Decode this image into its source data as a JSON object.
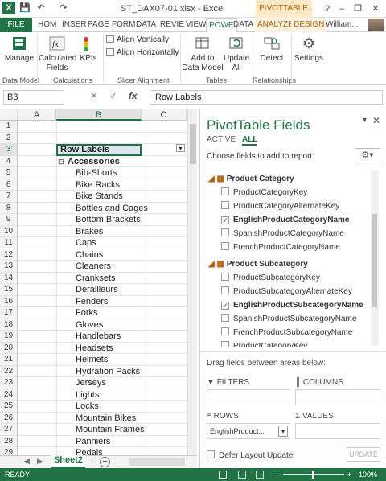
{
  "window": {
    "title": "ST_DAX07-01.xlsx - Excel",
    "pivot_context": "PIVOTTABLE...",
    "help": "?",
    "minimize": "–",
    "restore": "❐",
    "close": "✕"
  },
  "quick_access": {
    "save": "💾",
    "undo": "↶",
    "redo": "↷"
  },
  "tabs": [
    "FILE",
    "HOM",
    "INSER",
    "PAGE",
    "FORM",
    "DATA",
    "REVIE",
    "VIEW",
    "POWE",
    "DATA",
    "ANALYZE",
    "DESIGN"
  ],
  "active_tab": "POWE",
  "user": "William...",
  "ribbon": {
    "manage": "Manage",
    "calc_fields": "Calculated",
    "calc_fields2": "Fields",
    "kpis": "KPIs",
    "align_v": "Align Vertically",
    "align_h": "Align Horizontally",
    "add_dm": "Add to",
    "add_dm2": "Data Model",
    "update_all": "Update",
    "update_all2": "All",
    "detect": "Detect",
    "settings": "Settings",
    "groups": {
      "data_model": "Data Model",
      "calculations": "Calculations",
      "slicer": "Slicer Alignment",
      "tables": "Tables",
      "relationships": "Relationships"
    }
  },
  "formula_bar": {
    "name_box": "B3",
    "value": "Row Labels",
    "fx": "fx",
    "cancel": "✕",
    "enter": "✓"
  },
  "grid": {
    "columns": [
      "A",
      "B",
      "C"
    ],
    "rows": [
      {
        "n": "1",
        "b": ""
      },
      {
        "n": "2",
        "b": ""
      },
      {
        "n": "3",
        "b": "Row Labels"
      },
      {
        "n": "4",
        "b": "Accessories"
      },
      {
        "n": "5",
        "b": "Bib-Shorts"
      },
      {
        "n": "6",
        "b": "Bike Racks"
      },
      {
        "n": "7",
        "b": "Bike Stands"
      },
      {
        "n": "8",
        "b": "Bottles and Cages"
      },
      {
        "n": "9",
        "b": "Bottom Brackets"
      },
      {
        "n": "10",
        "b": "Brakes"
      },
      {
        "n": "11",
        "b": "Caps"
      },
      {
        "n": "12",
        "b": "Chains"
      },
      {
        "n": "13",
        "b": "Cleaners"
      },
      {
        "n": "14",
        "b": "Cranksets"
      },
      {
        "n": "15",
        "b": "Derailleurs"
      },
      {
        "n": "16",
        "b": "Fenders"
      },
      {
        "n": "17",
        "b": "Forks"
      },
      {
        "n": "18",
        "b": "Gloves"
      },
      {
        "n": "19",
        "b": "Handlebars"
      },
      {
        "n": "20",
        "b": "Headsets"
      },
      {
        "n": "21",
        "b": "Helmets"
      },
      {
        "n": "22",
        "b": "Hydration Packs"
      },
      {
        "n": "23",
        "b": "Jerseys"
      },
      {
        "n": "24",
        "b": "Lights"
      },
      {
        "n": "25",
        "b": "Locks"
      },
      {
        "n": "26",
        "b": "Mountain Bikes"
      },
      {
        "n": "27",
        "b": "Mountain Frames"
      },
      {
        "n": "28",
        "b": "Panniers"
      },
      {
        "n": "29",
        "b": "Pedals"
      }
    ]
  },
  "sheets": {
    "active": "Sheet2",
    "more": "...",
    "add": "+"
  },
  "panel": {
    "title": "PivotTable Fields",
    "tab_active": "ACTIVE",
    "tab_all": "ALL",
    "choose": "Choose fields to add to report:",
    "tables": [
      {
        "name": "Product Category",
        "fields": [
          {
            "label": "ProductCategoryKey",
            "checked": false
          },
          {
            "label": "ProductCategoryAlternateKey",
            "checked": false
          },
          {
            "label": "EnglishProductCategoryName",
            "checked": true
          },
          {
            "label": "SpanishProductCategoryName",
            "checked": false
          },
          {
            "label": "FrenchProductCategoryName",
            "checked": false
          }
        ]
      },
      {
        "name": "Product Subcategory",
        "fields": [
          {
            "label": "ProductSubcategoryKey",
            "checked": false
          },
          {
            "label": "ProductSubcategoryAlternateKey",
            "checked": false
          },
          {
            "label": "EnglishProductSubcategoryName",
            "checked": true
          },
          {
            "label": "SpanishProductSubcategoryName",
            "checked": false
          },
          {
            "label": "FrenchProductSubcategoryName",
            "checked": false
          },
          {
            "label": "ProductCategoryKey",
            "checked": false
          }
        ]
      }
    ],
    "drag_label": "Drag fields between areas below:",
    "filters": "FILTERS",
    "columns": "COLUMNS",
    "rows": "ROWS",
    "values": "VALUES",
    "rows_item": "EnglishProduct...",
    "defer": "Defer Layout Update",
    "update": "UPDATE"
  },
  "status": {
    "ready": "READY",
    "zoom": "100%",
    "minus": "–",
    "plus": "+"
  }
}
